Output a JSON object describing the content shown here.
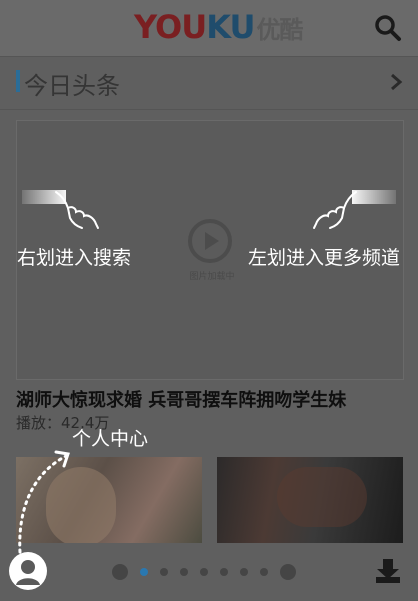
{
  "header": {
    "logo_you": "YOU",
    "logo_ku": "KU",
    "logo_cn": "优酷",
    "search_icon": "search-icon"
  },
  "section": {
    "title": "今日头条",
    "chevron_icon": "chevron-right-icon"
  },
  "video": {
    "play_icon": "play-icon",
    "loading_text": "图片加载中",
    "title": "湖师大惊现求婚 兵哥哥摆车阵拥吻学生妹",
    "play_count": "播放：42.4万"
  },
  "gestures": {
    "swipe_right_hint": "右划进入搜索",
    "swipe_left_hint": "左划进入更多频道",
    "personal_center_hint": "个人中心"
  },
  "bottom_bar": {
    "avatar_icon": "user-avatar-icon",
    "download_icon": "download-icon",
    "pager": {
      "total_dots": 8,
      "active_index": 1
    }
  },
  "colors": {
    "accent_blue": "#2a78b0",
    "overlay_text": "#ffffff"
  }
}
